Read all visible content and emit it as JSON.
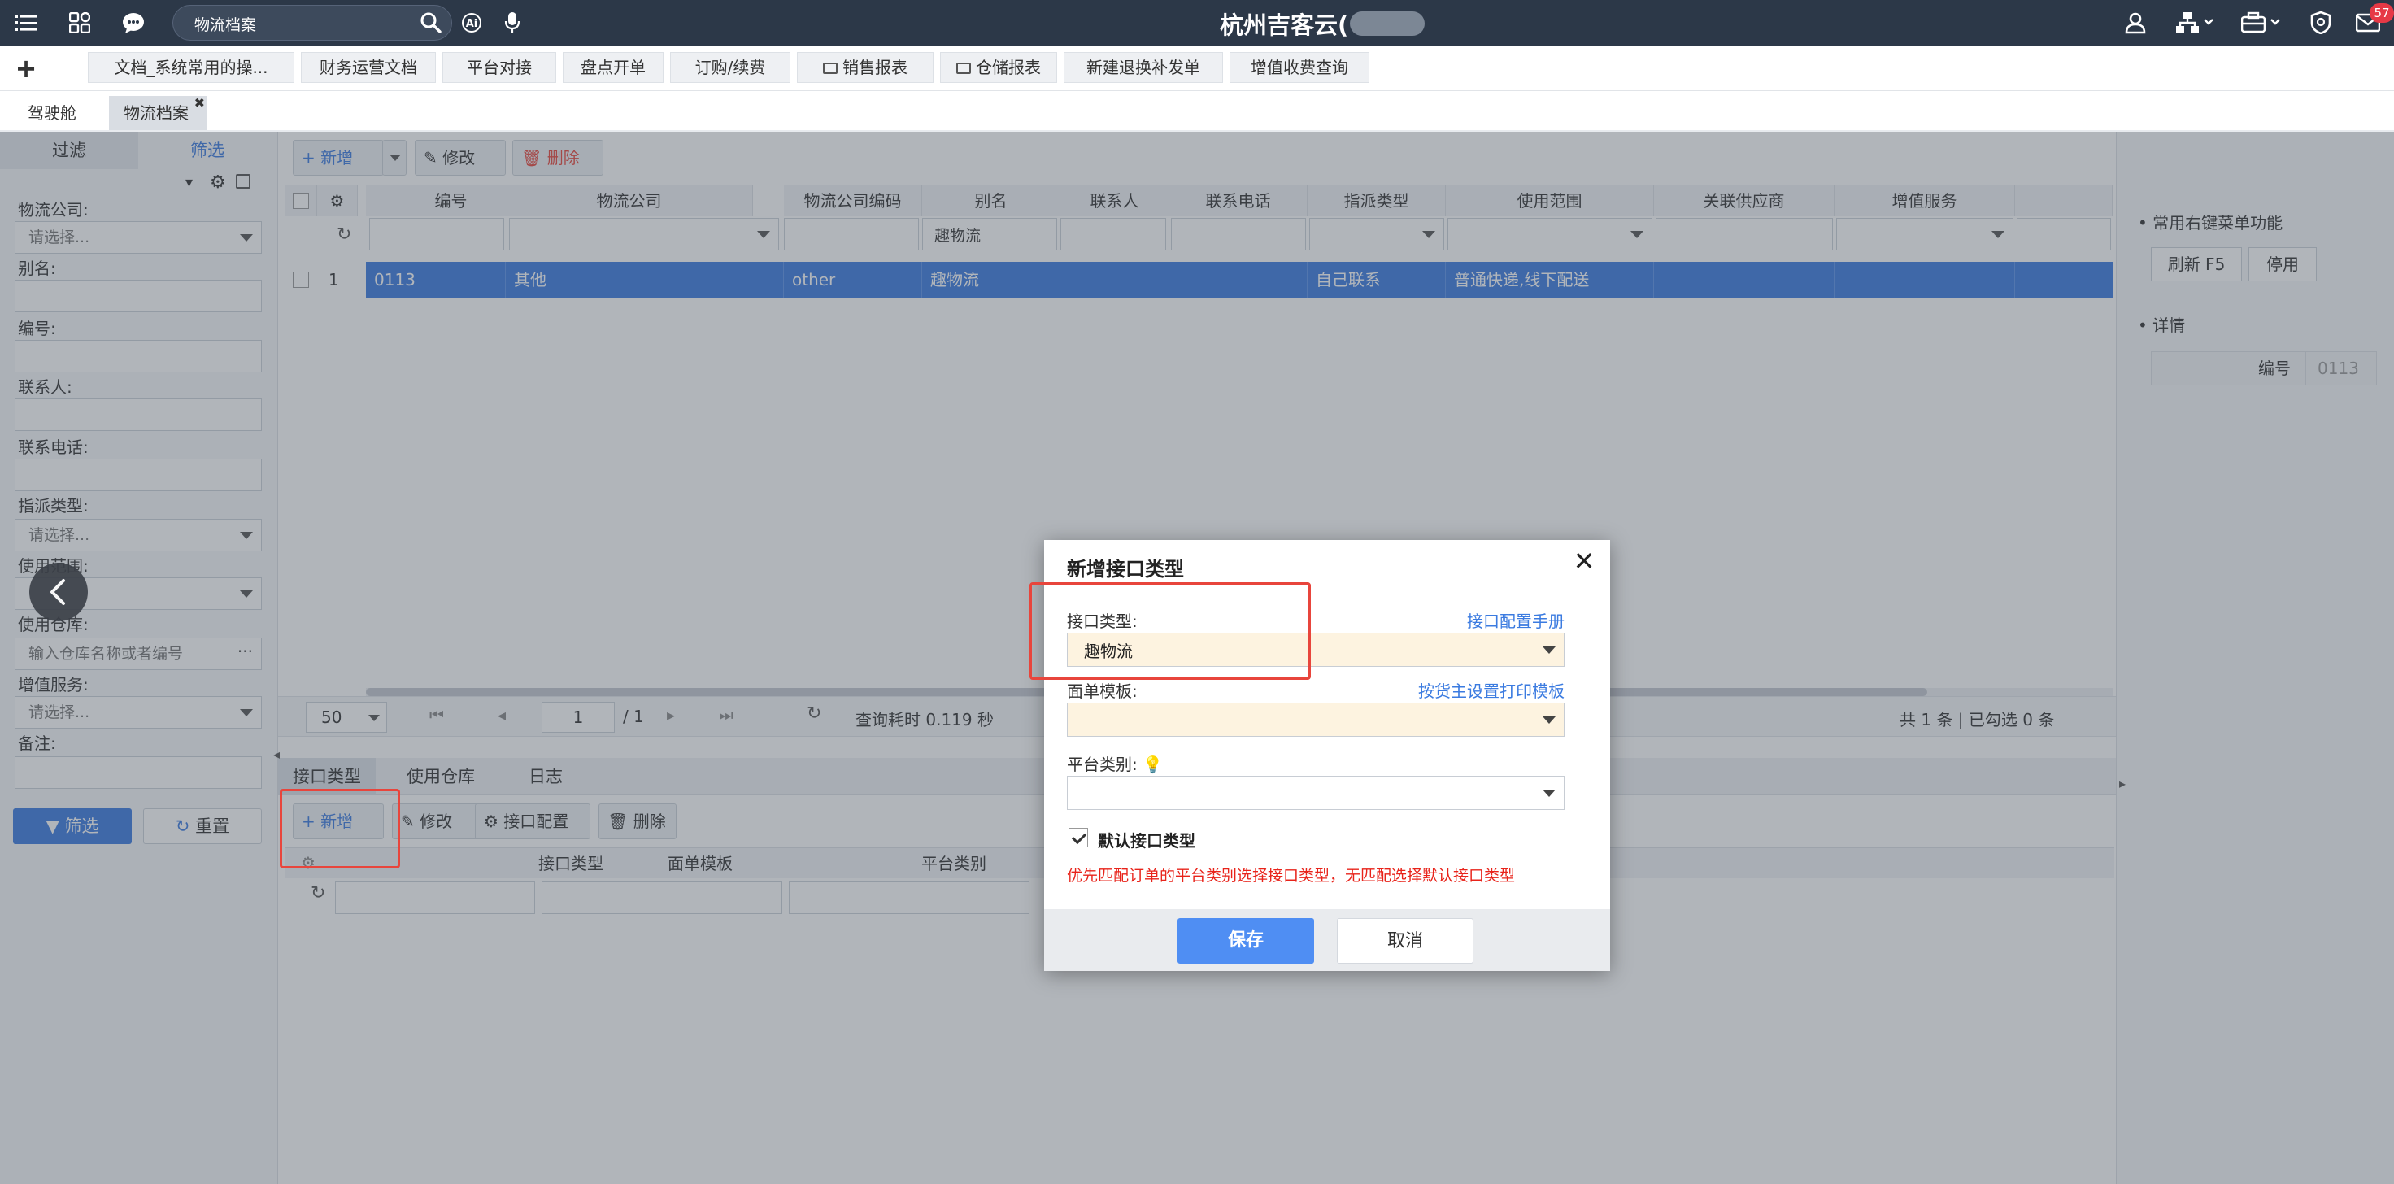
{
  "header": {
    "search_value": "物流档案",
    "app_title": "杭州吉客云(",
    "notification_count": "57",
    "icons": [
      "menu-icon",
      "apps-icon",
      "chat-icon",
      "search-icon",
      "ai-icon",
      "mic-icon",
      "user-icon",
      "org-icon",
      "briefcase-icon",
      "shield-icon",
      "mail-icon"
    ]
  },
  "quickbar": {
    "items": [
      "文档_系统常用的操...",
      "财务运营文档",
      "平台对接",
      "盘点开单",
      "订购/续费",
      "销售报表",
      "仓储报表",
      "新建退换补发单",
      "增值收费查询"
    ]
  },
  "page_tabs": [
    "驾驶舱",
    "物流档案"
  ],
  "left_panel": {
    "tabs": [
      "过滤",
      "筛选"
    ],
    "fields": [
      {
        "label": "物流公司:",
        "placeholder": "请选择..."
      },
      {
        "label": "别名:",
        "placeholder": ""
      },
      {
        "label": "编号:",
        "placeholder": ""
      },
      {
        "label": "联系人:",
        "placeholder": ""
      },
      {
        "label": "联系电话:",
        "placeholder": ""
      },
      {
        "label": "指派类型:",
        "placeholder": "请选择..."
      },
      {
        "label": "使用范围:",
        "placeholder": ""
      },
      {
        "label": "使用仓库:",
        "placeholder": "输入仓库名称或者编号"
      },
      {
        "label": "增值服务:",
        "placeholder": "请选择..."
      },
      {
        "label": "备注:",
        "placeholder": ""
      }
    ],
    "filter_button": "筛选",
    "reset_button": "重置"
  },
  "toolbar": {
    "add": "新增",
    "edit": "修改",
    "delete": "删除"
  },
  "table": {
    "columns": [
      "编号",
      "物流公司",
      "物流公司编码",
      "别名",
      "联系人",
      "联系电话",
      "指派类型",
      "使用范围",
      "关联供应商",
      "增值服务"
    ],
    "alias_filter_value": "趣物流",
    "rows": [
      {
        "index": "1",
        "code": "0113",
        "company": "其他",
        "company_code": "other",
        "alias": "趣物流",
        "contact": "",
        "phone": "",
        "assign_type": "自己联系",
        "scope": "普通快递,线下配送",
        "supplier": "",
        "service": ""
      }
    ]
  },
  "pager": {
    "page_size": "50",
    "page": "1",
    "total_pages": "/ 1",
    "query_time": "查询耗时 0.119 秒",
    "summary": "共 1 条 | 已勾选 0 条"
  },
  "sub_tabs": [
    "接口类型",
    "使用仓库",
    "日志"
  ],
  "sub_toolbar": {
    "add": "新增",
    "edit": "修改",
    "config": "接口配置",
    "delete": "删除"
  },
  "sub_columns": [
    "接口类型",
    "面单模板",
    "平台类别"
  ],
  "right_panel": {
    "section1": "常用右键菜单功能",
    "refresh": "刷新 F5",
    "disable": "停用",
    "section2": "详情",
    "code_label": "编号",
    "code_value": "0113"
  },
  "dialog": {
    "title": "新增接口类型",
    "interface_label": "接口类型:",
    "manual_link": "接口配置手册",
    "interface_value": "趣物流",
    "template_label": "面单模板:",
    "template_link": "按货主设置打印模板",
    "template_value": "",
    "platform_label": "平台类别:",
    "platform_value": "",
    "default_label": "默认接口类型",
    "hint": "优先匹配订单的平台类别选择接口类型，无匹配选择默认接口类型",
    "save": "保存",
    "cancel": "取消"
  },
  "colors": {
    "accent": "#3b7be0",
    "header_bg": "#2c3848",
    "warning_text": "#e8231a",
    "highlight_box": "#e8453c",
    "required_bg": "#fdf3e0"
  }
}
